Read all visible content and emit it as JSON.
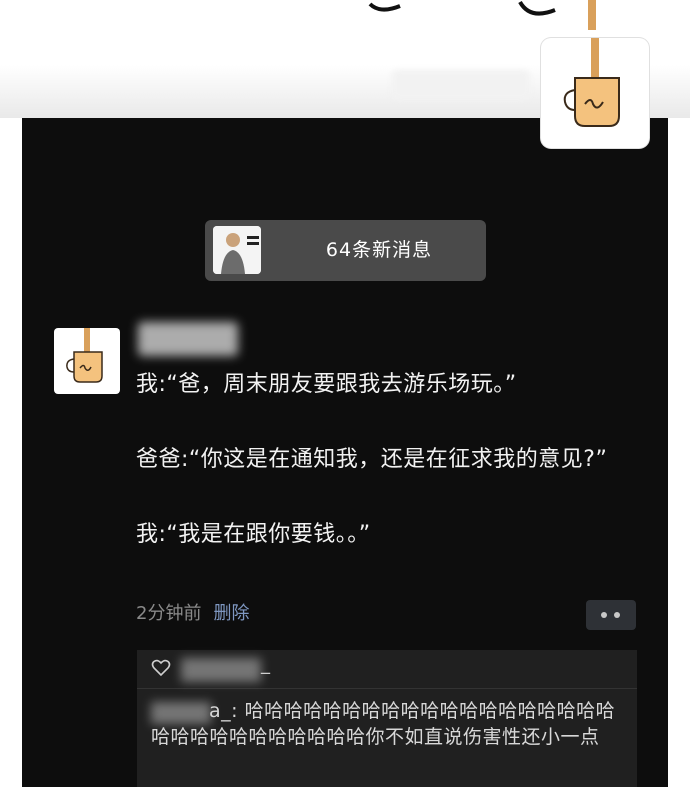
{
  "banner": {
    "new_messages": "64条新消息"
  },
  "post": {
    "lines": [
      "我:“爸，周末朋友要跟我去游乐场玩。”",
      "爸爸:“你这是在通知我，还是在征求我的意见?”",
      "我:“我是在跟你要钱。。”"
    ],
    "time": "2分钟前",
    "delete_label": "删除"
  },
  "likes": {
    "name_tail": "_"
  },
  "comment": {
    "author_tail": "a_:",
    "text": "哈哈哈哈哈哈哈哈哈哈哈哈哈哈哈哈哈哈哈哈哈哈哈哈哈哈哈哈哈哈你不如直说伤害性还小一点"
  },
  "icons": [
    "mug-icon",
    "heart-icon",
    "more-icon"
  ],
  "colors": {
    "background": "#0d0d0d",
    "link": "#7f98c2",
    "notice": "#4a4a4a"
  }
}
